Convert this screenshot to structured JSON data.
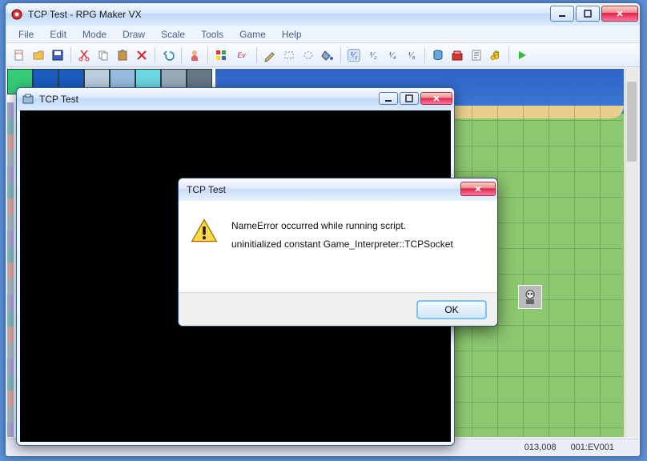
{
  "app": {
    "title": "TCP Test - RPG Maker VX",
    "menu": [
      "File",
      "Edit",
      "Mode",
      "Draw",
      "Scale",
      "Tools",
      "Game",
      "Help"
    ],
    "fractions": [
      "¹⁄₁",
      "¹⁄₂",
      "¹⁄₄",
      "¹⁄₈"
    ]
  },
  "status": {
    "coords": "013,008",
    "event": "001:EV001"
  },
  "game_window": {
    "title": "TCP Test"
  },
  "dialog": {
    "title": "TCP Test",
    "line1": "NameError occurred while running script.",
    "line2": "uninitialized constant Game_Interpreter::TCPSocket",
    "ok": "OK"
  }
}
